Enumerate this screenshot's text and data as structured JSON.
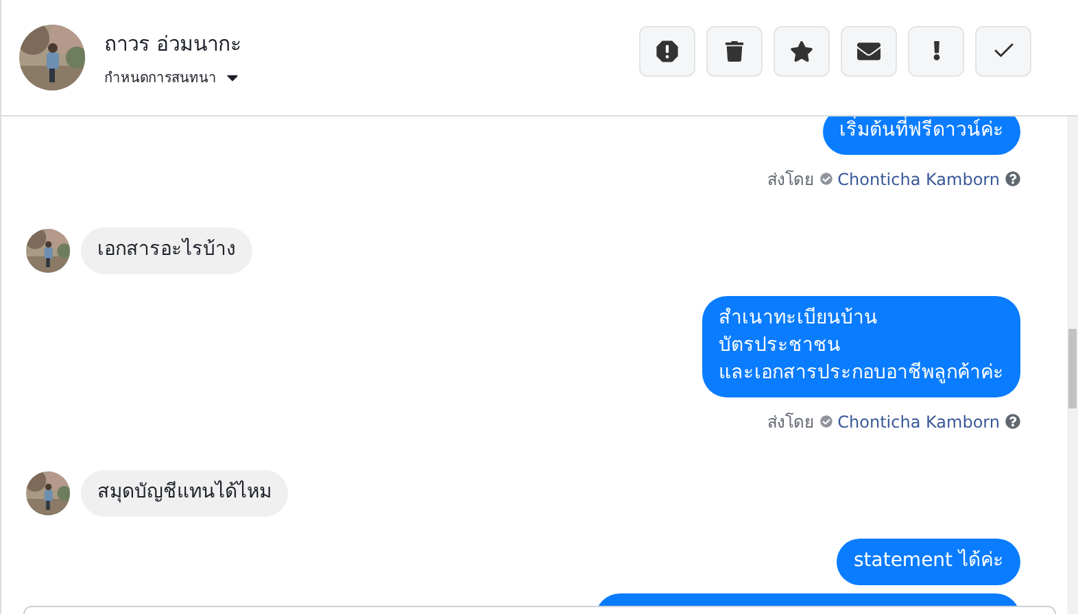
{
  "header": {
    "name": "ถาวร อ่วมนากะ",
    "subtitle": "กำหนดการสนทนา",
    "actions": [
      {
        "kind": "report"
      },
      {
        "kind": "delete"
      },
      {
        "kind": "star"
      },
      {
        "kind": "unread"
      },
      {
        "kind": "important"
      },
      {
        "kind": "done"
      }
    ]
  },
  "messages": [
    {
      "kind": "out",
      "lines": [
        "เริ่มต้นที่ฟรีดาวน์ค่ะ"
      ],
      "sent_by_label": "ส่งโดย",
      "sender": "Chonticha Kamborn"
    },
    {
      "kind": "in",
      "lines": [
        "เอกสารอะไรบ้าง"
      ]
    },
    {
      "kind": "out",
      "lines": [
        "สำเนาทะเบียนบ้าน",
        "บัตรประชาชน",
        "และเอกสารประกอบอาชีพลูกค้าค่ะ"
      ],
      "sent_by_label": "ส่งโดย",
      "sender": "Chonticha Kamborn"
    },
    {
      "kind": "in",
      "lines": [
        "สมุดบัญชีแทนได้ไหม"
      ]
    },
    {
      "kind": "out",
      "lines": [
        "statement ได้ค่ะ"
      ]
    },
    {
      "kind": "clipped"
    }
  ]
}
